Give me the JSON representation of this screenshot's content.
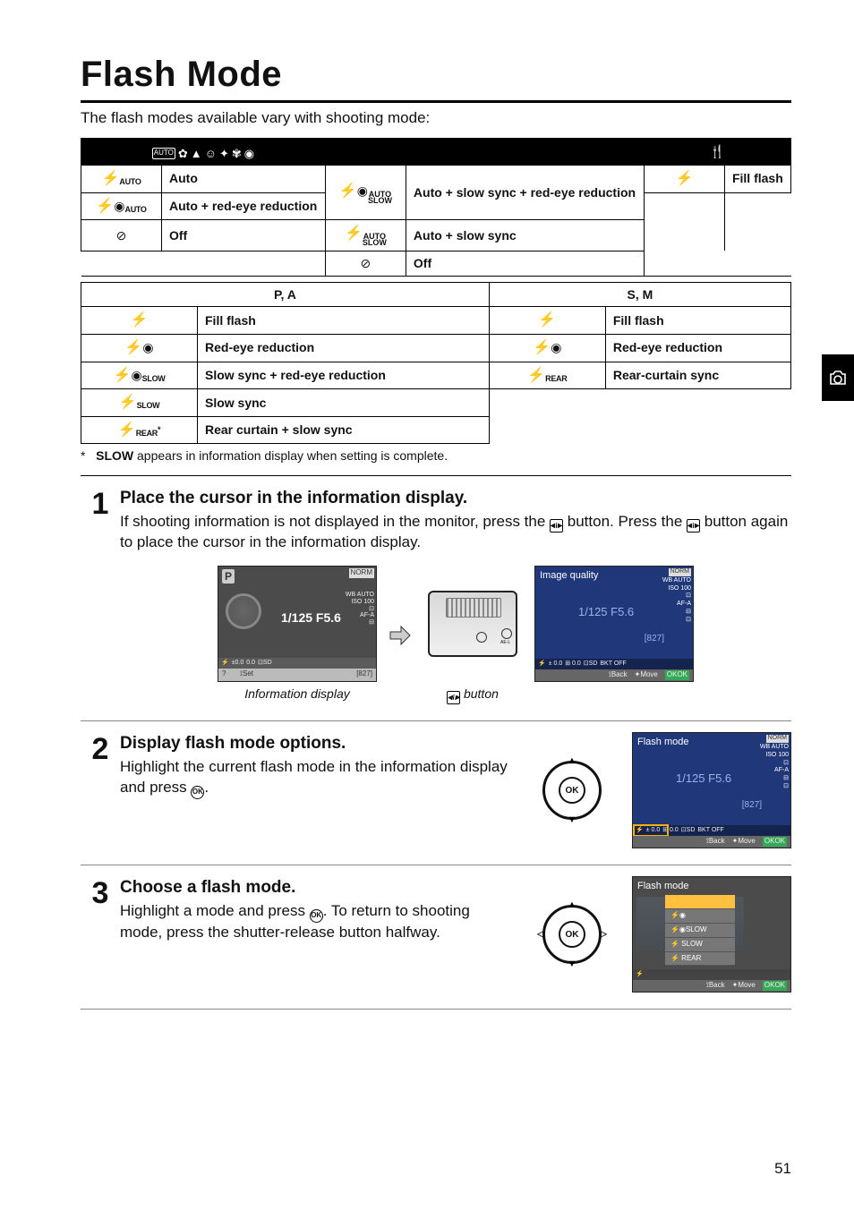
{
  "title": "Flash Mode",
  "intro": "The flash modes available vary with shooting mode:",
  "side_tab_icon": "camera-icon",
  "page_number": "51",
  "table_top": {
    "headers": [
      {
        "icons": "mode-auto-portrait-landscape-child-sports-closeup-night"
      },
      {
        "icons": "night-portrait"
      },
      {
        "icons": "food"
      }
    ],
    "rows_col1": [
      {
        "icon": "bolt-auto",
        "label": "Auto"
      },
      {
        "icon": "bolt-eye-auto",
        "label": "Auto + red-eye reduction"
      },
      {
        "icon": "circle-off",
        "label": "Off"
      }
    ],
    "rows_col2": [
      {
        "icon": "bolt-eye-auto-slow",
        "label": "Auto + slow sync + red-eye reduction"
      },
      {
        "icon": "bolt-auto-slow",
        "label": "Auto + slow sync"
      },
      {
        "icon": "circle-off",
        "label": "Off"
      }
    ],
    "rows_col3": [
      {
        "icon": "bolt",
        "label": "Fill flash"
      }
    ]
  },
  "table_bot": {
    "header_left": "P, A",
    "header_right": "S, M",
    "rows_left": [
      {
        "icon": "bolt",
        "label": "Fill flash"
      },
      {
        "icon": "bolt-eye",
        "label": "Red-eye reduction"
      },
      {
        "icon": "bolt-eye-slow",
        "label": "Slow sync + red-eye reduction"
      },
      {
        "icon": "bolt-slow",
        "label": "Slow sync"
      },
      {
        "icon": "bolt-rear-star",
        "label": "Rear curtain + slow sync"
      }
    ],
    "rows_right": [
      {
        "icon": "bolt",
        "label": "Fill flash"
      },
      {
        "icon": "bolt-eye",
        "label": "Red-eye reduction"
      },
      {
        "icon": "bolt-rear",
        "label": "Rear-curtain sync"
      }
    ]
  },
  "footnote_star": "*",
  "footnote_pre": " ",
  "footnote_bold": "SLOW",
  "footnote_rest": " appears in information display when setting is complete.",
  "steps": [
    {
      "no": "1",
      "title": "Place the cursor in the information display.",
      "text_parts": [
        "If shooting information is not displayed in the monitor, press the ",
        " button. Press the ",
        " button again to place the cursor in the information display."
      ],
      "illus": {
        "info_display": {
          "p": "P",
          "center": "1/125   F5.6",
          "norm": "NORM",
          "iso": "WB AUTO\nISO 100",
          "strip_items": [
            "⚡",
            "±0.0",
            "0.0",
            "⊡SD"
          ],
          "bottom_left_help": "?",
          "bottom_left": "Set",
          "bottom_right": "[827]",
          "caption": "Information display"
        },
        "cam_caption": " button",
        "blue_iq": {
          "title": "Image quality",
          "mid": "1/125    F5.6",
          "count": "[827]",
          "right": "NORM\nWB AUTO\nISO 100\n⊡\nAF-A\n⊟\n⊡",
          "strip": [
            "⚡",
            "± 0.0",
            "⊞ 0.0",
            "⊡SD",
            "BKT OFF"
          ],
          "bottom": [
            "Back",
            "Move",
            "OK"
          ]
        }
      }
    },
    {
      "no": "2",
      "title": "Display flash mode options.",
      "text_parts": [
        "Highlight the current flash mode in the information display and press ",
        "."
      ],
      "illus": {
        "blue_fm": {
          "title": "Flash mode",
          "mid": "1/125    F5.6",
          "count": "[827]",
          "right": "NORM\nWB AUTO\nISO 100\n⊡\nAF-A\n⊟\n⊡",
          "strip": [
            "⚡",
            "± 0.0",
            "⊞ 0.0",
            "⊡SD",
            "BKT OFF"
          ],
          "bottom": [
            "Back",
            "Move",
            "OK"
          ]
        }
      }
    },
    {
      "no": "3",
      "title": "Choose a flash mode.",
      "text_parts": [
        "Highlight a mode and press ",
        ".  To return to shooting mode, press the shutter-release button halfway."
      ],
      "illus": {
        "menu": {
          "title": "Flash mode",
          "items": [
            "⚡",
            "⚡◉",
            "⚡◉SLOW",
            "⚡ SLOW",
            "⚡ REAR"
          ],
          "selected_index": 0,
          "strip": [
            "⚡"
          ],
          "bottom": [
            "Back",
            "Move",
            "OK"
          ]
        }
      }
    }
  ]
}
